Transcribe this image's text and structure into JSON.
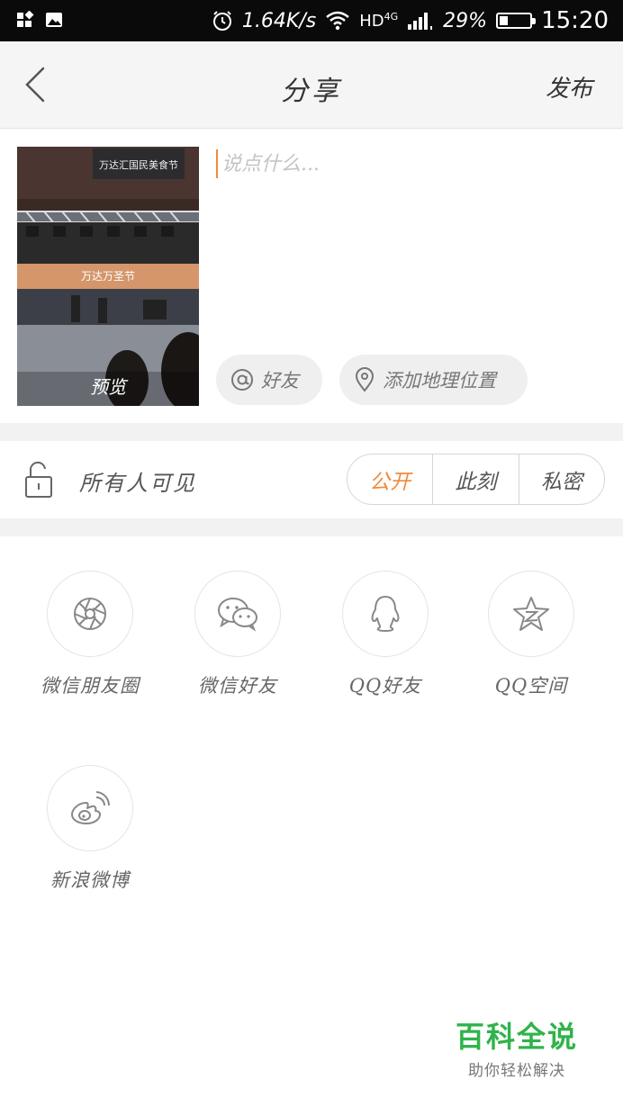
{
  "status_bar": {
    "speed": "1.64K/s",
    "network": "HD",
    "network_gen": "4G",
    "battery_percent": "29%",
    "battery_level": 0.29,
    "time": "15:20"
  },
  "header": {
    "title": "分享",
    "publish_label": "发布",
    "back_icon": "chevron-left-icon"
  },
  "compose": {
    "caption_placeholder": "说点什么...",
    "caption_value": "",
    "thumbnail": {
      "preview_label": "预览",
      "sign_text": "万达汇国民美食节",
      "banner_text": "万达万圣节"
    },
    "mention_button": "好友",
    "location_button": "添加地理位置"
  },
  "visibility": {
    "label": "所有人可见",
    "options": [
      "公开",
      "此刻",
      "私密"
    ],
    "selected": "公开"
  },
  "share_targets": [
    {
      "label": "微信朋友圈",
      "icon": "wechat-moments-icon"
    },
    {
      "label": "微信好友",
      "icon": "wechat-icon"
    },
    {
      "label": "QQ好友",
      "icon": "qq-icon"
    },
    {
      "label": "QQ空间",
      "icon": "qzone-icon"
    },
    {
      "label": "新浪微博",
      "icon": "weibo-icon"
    }
  ],
  "watermark": {
    "title": "百科全说",
    "subtitle": "助你轻松解决"
  },
  "colors": {
    "accent": "#f08a3c",
    "watermark_green": "#2fb34a",
    "header_bg": "#f5f5f5"
  }
}
